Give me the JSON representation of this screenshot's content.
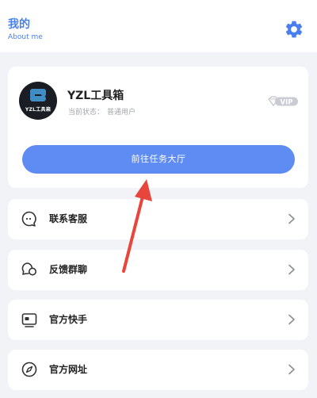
{
  "header": {
    "title": "我的",
    "subtitle": "About me",
    "settings_icon": "gear-icon",
    "accent_color": "#4a7ff0"
  },
  "profile": {
    "name": "YZL工具箱",
    "status_label": "当前状态：",
    "status_value": "普通用户",
    "avatar_text": "YZL工具箱",
    "vip_label": "VIP"
  },
  "primary_action": {
    "label": "前往任务大厅",
    "color": "#5e8cf3"
  },
  "menu": {
    "items": [
      {
        "label": "联系客服",
        "icon": "chat-bubble-icon"
      },
      {
        "label": "反馈群聊",
        "icon": "group-chat-icon"
      },
      {
        "label": "官方快手",
        "icon": "id-card-icon"
      },
      {
        "label": "官方网址",
        "icon": "compass-icon"
      }
    ]
  },
  "annotation": {
    "arrow_color": "#e8453c"
  }
}
